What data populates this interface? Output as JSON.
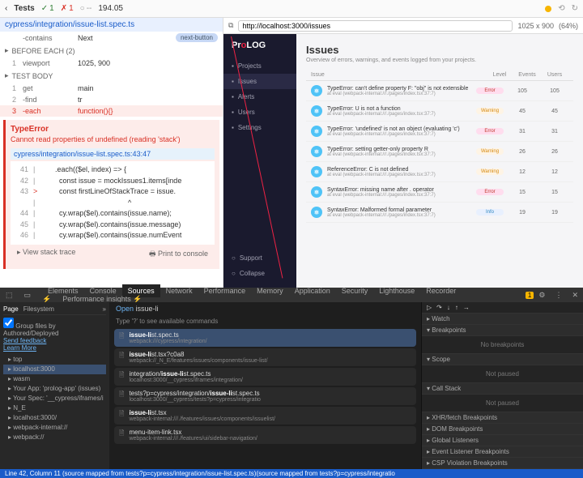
{
  "toolbar": {
    "tests": "Tests",
    "pass": "1",
    "fail": "1",
    "pending": "--",
    "time": "194.05"
  },
  "spec": "cypress/integration/issue-list.spec.ts",
  "log": {
    "contains": {
      "num": "",
      "cmd": "-contains",
      "val": "Next",
      "badge": "next-button"
    },
    "before": "BEFORE EACH (2)",
    "viewport": {
      "num": "1",
      "cmd": "viewport",
      "val": "1025, 900"
    },
    "body": "TEST BODY",
    "get": {
      "num": "1",
      "cmd": "get",
      "val": "main"
    },
    "find": {
      "num": "2",
      "cmd": "-find",
      "val": "tr"
    },
    "each": {
      "num": "3",
      "cmd": "-each",
      "val": "function(){}"
    }
  },
  "error": {
    "title": "TypeError",
    "msg": "Cannot read properties of undefined (reading 'stack')",
    "file": "cypress/integration/issue-list.spec.ts:43:47",
    "code": [
      {
        "ln": "41",
        "mark": "|",
        "code": "      .each(($el, index) => {"
      },
      {
        "ln": "42",
        "mark": "|",
        "code": "        const issue = mockIssues1.items[inde"
      },
      {
        "ln": "43",
        "mark": ">",
        "code": "        const firstLineOfStackTrace = issue."
      },
      {
        "ln": "",
        "mark": "|",
        "code": "                                          ^"
      },
      {
        "ln": "44",
        "mark": "|",
        "code": "        cy.wrap($el).contains(issue.name);"
      },
      {
        "ln": "45",
        "mark": "|",
        "code": "        cy.wrap($el).contains(issue.message)"
      },
      {
        "ln": "46",
        "mark": "|",
        "code": "        cy.wrap($el).contains(issue.numEvent"
      }
    ],
    "stack": "View stack trace",
    "print": "Print to console"
  },
  "url": {
    "value": "http://localhost:3000/issues",
    "dim": "1025 x 900",
    "zoom": "(64%)"
  },
  "app": {
    "logo": {
      "p": "Pr",
      "o": "o",
      "log": "LOG"
    },
    "nav": [
      {
        "icon": "projects",
        "label": "Projects"
      },
      {
        "icon": "issues",
        "label": "Issues"
      },
      {
        "icon": "alerts",
        "label": "Alerts"
      },
      {
        "icon": "users",
        "label": "Users"
      },
      {
        "icon": "settings",
        "label": "Settings"
      }
    ],
    "navBottom": [
      {
        "icon": "support",
        "label": "Support"
      },
      {
        "icon": "collapse",
        "label": "Collapse"
      }
    ],
    "title": "Issues",
    "subtitle": "Overview of errors, warnings, and events logged from your projects.",
    "cols": {
      "issue": "Issue",
      "level": "Level",
      "events": "Events",
      "users": "Users"
    },
    "rows": [
      {
        "title": "TypeError: can't define property F: \"obj\" is not extensible",
        "meta": "at eval (webpack-internal:///./pages/index.tsx:37:7)",
        "level": "Error",
        "events": "105",
        "users": "105"
      },
      {
        "title": "TypeError: U is not a function",
        "meta": "at eval (webpack-internal:///./pages/index.tsx:37:7)",
        "level": "Warning",
        "events": "45",
        "users": "45"
      },
      {
        "title": "TypeError: 'undefined' is not an object (evaluating 'c')",
        "meta": "at eval (webpack-internal:///./pages/index.tsx:37:7)",
        "level": "Error",
        "events": "31",
        "users": "31"
      },
      {
        "title": "TypeError: setting getter-only property R",
        "meta": "at eval (webpack-internal:///./pages/index.tsx:37:7)",
        "level": "Warning",
        "events": "26",
        "users": "26"
      },
      {
        "title": "ReferenceError: C is not defined",
        "meta": "at eval (webpack-internal:///./pages/index.tsx:37:7)",
        "level": "Warning",
        "events": "12",
        "users": "12"
      },
      {
        "title": "SyntaxError: missing name after . operator",
        "meta": "at eval (webpack-internal:///./pages/index.tsx:37:7)",
        "level": "Error",
        "events": "15",
        "users": "15"
      },
      {
        "title": "SyntaxError: Malformed formal parameter",
        "meta": "at eval (webpack-internal:///./pages/index.tsx:37:7)",
        "level": "Info",
        "events": "19",
        "users": "19"
      }
    ]
  },
  "dt": {
    "tabs": [
      "Elements",
      "Console",
      "Sources",
      "Network",
      "Performance",
      "Memory",
      "Application",
      "Security",
      "Lighthouse",
      "Recorder ⚡",
      "Performance insights ⚡"
    ],
    "activeTab": 2,
    "warn": "1",
    "subtabs": {
      "page": "Page",
      "fs": "Filesystem"
    },
    "group": {
      "t1": "Group files by",
      "t2": "Authored/Deployed",
      "t3": "Send feedback",
      "t4": "Learn More"
    },
    "tree": [
      "top",
      "localhost:3000",
      "wasm",
      "Your App: 'prolog-app' (issues)",
      "Your Spec: '__cypress/iframes/i",
      "N_E",
      "localhost:3000/",
      "webpack-internal://",
      "webpack://"
    ],
    "open": {
      "label": "Open",
      "query": "issue-li",
      "hint": "Type '?' to see available commands"
    },
    "results": [
      {
        "name": "issue-list.spec.ts",
        "path": "webpack:///cypress/integration/"
      },
      {
        "name": "issue-list.tsx?c0a8",
        "path": "webpack://_N_E/features/issues/components/issue-list/"
      },
      {
        "name": "integration/issue-list.spec.ts",
        "path": "localhost:3000/__cypress/iframes/integration/"
      },
      {
        "name": "tests?p=cypress/integration/issue-list.spec.ts",
        "path": "localhost:3000/__cypress/tests?p=cypress/integratio"
      },
      {
        "name": "issue-list.tsx",
        "path": "webpack-internal:///./features/issues/components/issuelist/"
      },
      {
        "name": "menu-item-link.tsx",
        "path": "webpack-internal:///./features/ui/sidebar-navigation/"
      }
    ],
    "right": {
      "watch": "Watch",
      "bp": "Breakpoints",
      "nobp": "No breakpoints",
      "scope": "Scope",
      "np": "Not paused",
      "cs": "Call Stack",
      "xhr": "XHR/fetch Breakpoints",
      "dom": "DOM Breakpoints",
      "gl": "Global Listeners",
      "ev": "Event Listener Breakpoints",
      "csp": "CSP Violation Breakpoints"
    },
    "status": "Line 42, Column 11  (source mapped from tests?p=cypress/integration/issue-list.spec.ts)(source mapped from tests?p=cypress/integratio"
  }
}
